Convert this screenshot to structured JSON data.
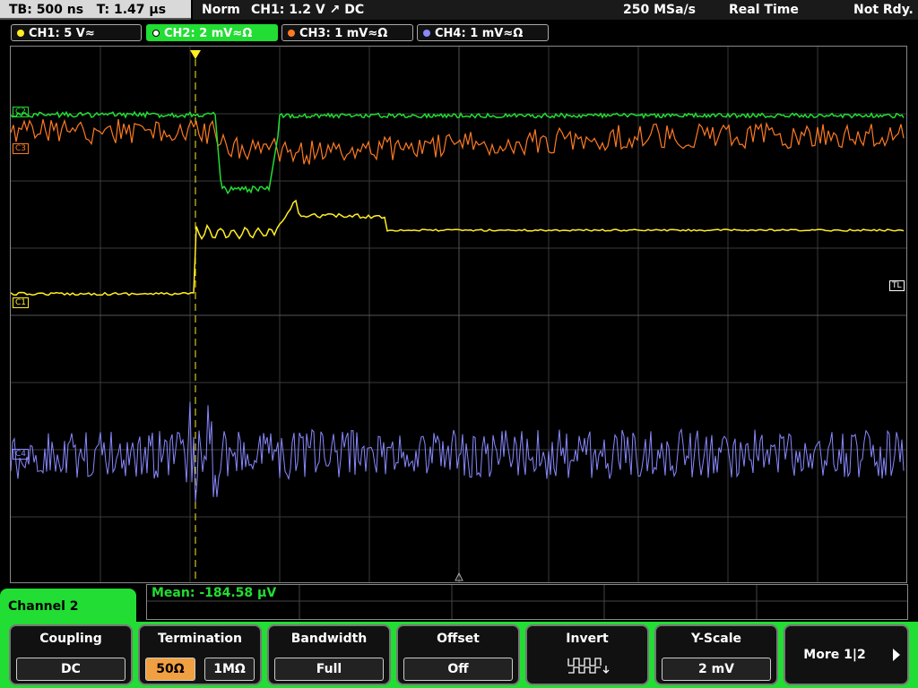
{
  "status": {
    "timebase": "TB: 500 ns",
    "trigger_time": "T: 1.47 µs",
    "mode": "Norm",
    "trigger_info": "CH1: 1.2 V ↗ DC",
    "sample_rate": "250 MSa/s",
    "acq_mode": "Real Time",
    "state": "Not Rdy."
  },
  "channels": [
    {
      "label": "CH1: 5 V≈",
      "color": "#ffee22"
    },
    {
      "label": "CH2: 2 mV≈Ω",
      "color": "#22dd33"
    },
    {
      "label": "CH3: 1 mV≈Ω",
      "color": "#ff7a22"
    },
    {
      "label": "CH4: 1 mV≈Ω",
      "color": "#8888ff"
    }
  ],
  "markers": {
    "c1": "C1",
    "c2": "C2",
    "c3": "C3",
    "c4": "C4",
    "trigger_level": "TL"
  },
  "menu": {
    "title": "Channel 2",
    "measurement": "Mean: -184.58 µV",
    "coupling": {
      "title": "Coupling",
      "value": "DC"
    },
    "termination": {
      "title": "Termination",
      "opt1": "50Ω",
      "opt2": "1MΩ"
    },
    "bandwidth": {
      "title": "Bandwidth",
      "value": "Full"
    },
    "offset": {
      "title": "Offset",
      "value": "Off"
    },
    "invert": {
      "title": "Invert"
    },
    "yscale": {
      "title": "Y-Scale",
      "value": "2 mV"
    },
    "more": "More 1|2"
  }
}
